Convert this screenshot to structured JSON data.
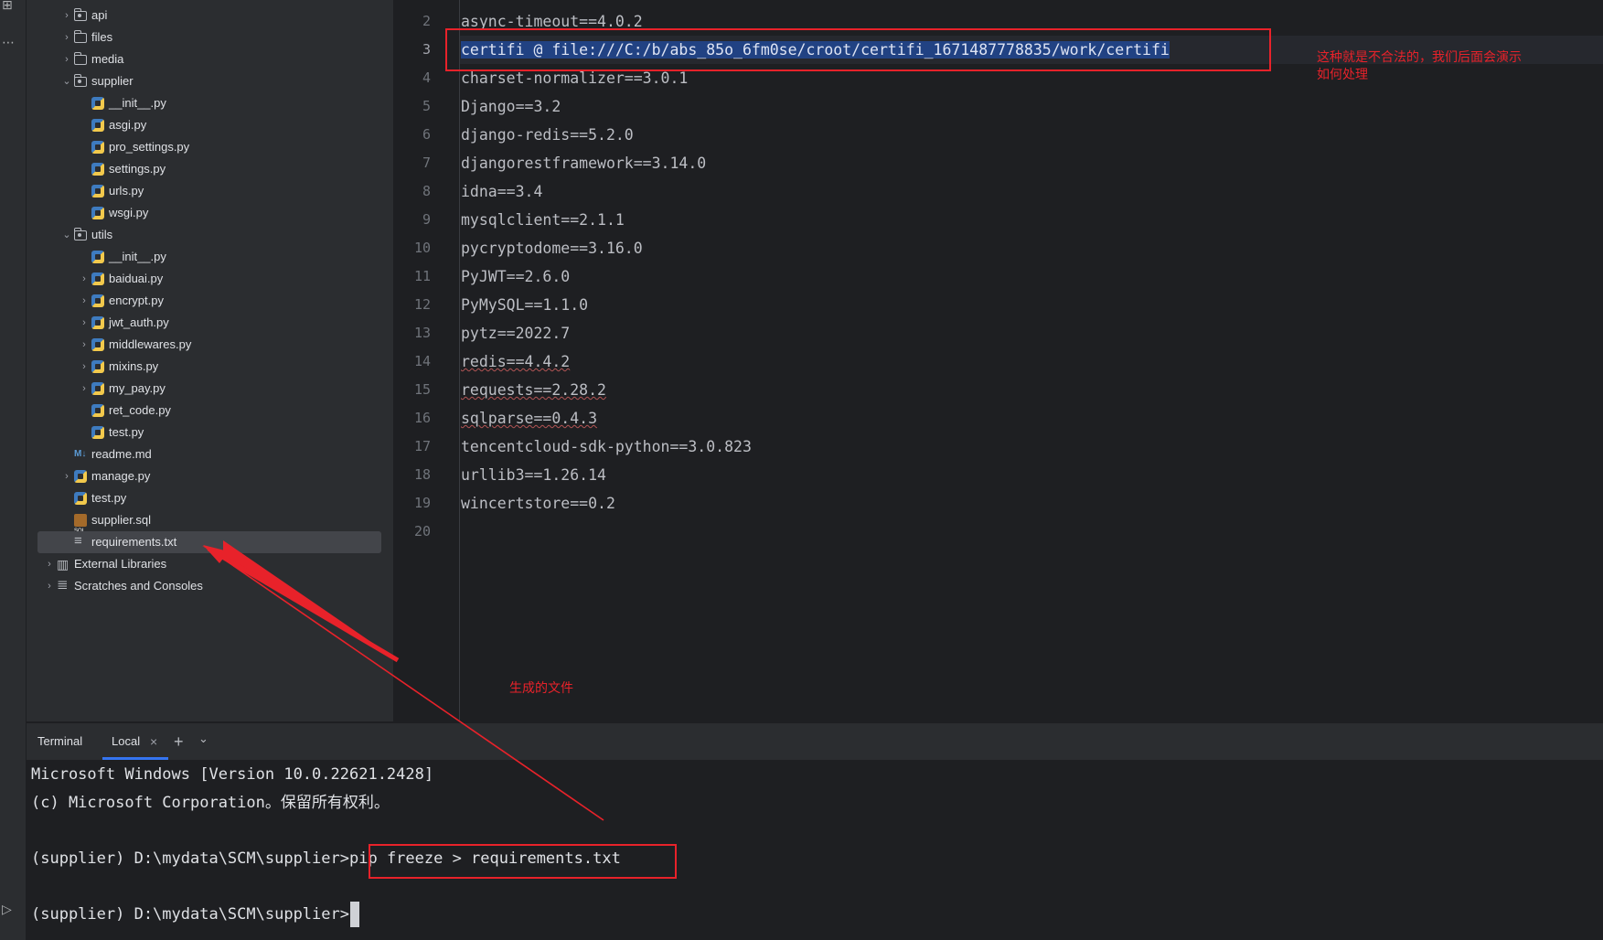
{
  "project_tree": [
    {
      "label": "api",
      "type": "folder",
      "indent": 1,
      "chevron": "›"
    },
    {
      "label": "files",
      "type": "folder",
      "indent": 1,
      "chevron": "›"
    },
    {
      "label": "media",
      "type": "folder",
      "indent": 1,
      "chevron": "›"
    },
    {
      "label": "supplier",
      "type": "folder",
      "indent": 1,
      "chevron": "⌄"
    },
    {
      "label": "__init__.py",
      "type": "py",
      "indent": 2,
      "chevron": ""
    },
    {
      "label": "asgi.py",
      "type": "py",
      "indent": 2,
      "chevron": ""
    },
    {
      "label": "pro_settings.py",
      "type": "py",
      "indent": 2,
      "chevron": ""
    },
    {
      "label": "settings.py",
      "type": "py",
      "indent": 2,
      "chevron": ""
    },
    {
      "label": "urls.py",
      "type": "py",
      "indent": 2,
      "chevron": ""
    },
    {
      "label": "wsgi.py",
      "type": "py",
      "indent": 2,
      "chevron": ""
    },
    {
      "label": "utils",
      "type": "folder",
      "indent": 1,
      "chevron": "⌄"
    },
    {
      "label": "__init__.py",
      "type": "py",
      "indent": 2,
      "chevron": ""
    },
    {
      "label": "baiduai.py",
      "type": "py",
      "indent": 2,
      "chevron": "›"
    },
    {
      "label": "encrypt.py",
      "type": "py",
      "indent": 2,
      "chevron": "›"
    },
    {
      "label": "jwt_auth.py",
      "type": "py",
      "indent": 2,
      "chevron": "›"
    },
    {
      "label": "middlewares.py",
      "type": "py",
      "indent": 2,
      "chevron": "›"
    },
    {
      "label": "mixins.py",
      "type": "py",
      "indent": 2,
      "chevron": "›"
    },
    {
      "label": "my_pay.py",
      "type": "py",
      "indent": 2,
      "chevron": "›"
    },
    {
      "label": "ret_code.py",
      "type": "py",
      "indent": 2,
      "chevron": ""
    },
    {
      "label": "test.py",
      "type": "py",
      "indent": 2,
      "chevron": ""
    },
    {
      "label": "readme.md",
      "type": "md",
      "indent": 1,
      "chevron": ""
    },
    {
      "label": "manage.py",
      "type": "py",
      "indent": 1,
      "chevron": "›"
    },
    {
      "label": "test.py",
      "type": "py",
      "indent": 1,
      "chevron": ""
    },
    {
      "label": "supplier.sql",
      "type": "sql",
      "indent": 1,
      "chevron": ""
    },
    {
      "label": "requirements.txt",
      "type": "txt",
      "indent": 1,
      "chevron": "",
      "selected": true
    },
    {
      "label": "External Libraries",
      "type": "lib",
      "indent": 0,
      "chevron": "›"
    },
    {
      "label": "Scratches and Consoles",
      "type": "scr",
      "indent": 0,
      "chevron": "›"
    }
  ],
  "editor": {
    "lines": [
      {
        "num": "2",
        "text": "async-timeout==4.0.2"
      },
      {
        "num": "3",
        "text": "certifi @ file:///C:/b/abs_85o_6fm0se/croot/certifi_1671487778835/work/certifi",
        "current": true,
        "selected": true
      },
      {
        "num": "4",
        "text": "charset-normalizer==3.0.1"
      },
      {
        "num": "5",
        "text": "Django==3.2"
      },
      {
        "num": "6",
        "text": "django-redis==5.2.0"
      },
      {
        "num": "7",
        "text": "djangorestframework==3.14.0"
      },
      {
        "num": "8",
        "text": "idna==3.4"
      },
      {
        "num": "9",
        "text": "mysqlclient==2.1.1"
      },
      {
        "num": "10",
        "text": "pycryptodome==3.16.0"
      },
      {
        "num": "11",
        "text": "PyJWT==2.6.0"
      },
      {
        "num": "12",
        "text": "PyMySQL==1.1.0"
      },
      {
        "num": "13",
        "text": "pytz==2022.7"
      },
      {
        "num": "14",
        "text": "redis==4.4.2",
        "squiggle": "red"
      },
      {
        "num": "15",
        "text": "requests==2.28.2",
        "squiggle": "red"
      },
      {
        "num": "16",
        "text": "sqlparse==0.4.3",
        "squiggle": "red"
      },
      {
        "num": "17",
        "text": "tencentcloud-sdk-python==3.0.823"
      },
      {
        "num": "18",
        "text": "urllib3==1.26.14"
      },
      {
        "num": "19",
        "text": "wincertstore==0.2"
      },
      {
        "num": "20",
        "text": ""
      }
    ]
  },
  "terminal": {
    "title": "Terminal",
    "tab_label": "Local",
    "close_glyph": "×",
    "add_glyph": "+",
    "menu_glyph": "⌄",
    "lines": [
      "Microsoft Windows [Version 10.0.22621.2428]",
      "(c) Microsoft Corporation。保留所有权利。",
      "",
      "(supplier) D:\\mydata\\SCM\\supplier>",
      "",
      "(supplier) D:\\mydata\\SCM\\supplier>"
    ],
    "command": "pip freeze > requirements.txt"
  },
  "annotations": {
    "illegal_note_line1": "这种就是不合法的，我们后面会演示",
    "illegal_note_line2": "如何处理",
    "generated_file_note": "生成的文件"
  },
  "colors": {
    "annotation_red": "#e8222a",
    "selection_blue": "#214283",
    "accent_blue": "#3574f0"
  }
}
